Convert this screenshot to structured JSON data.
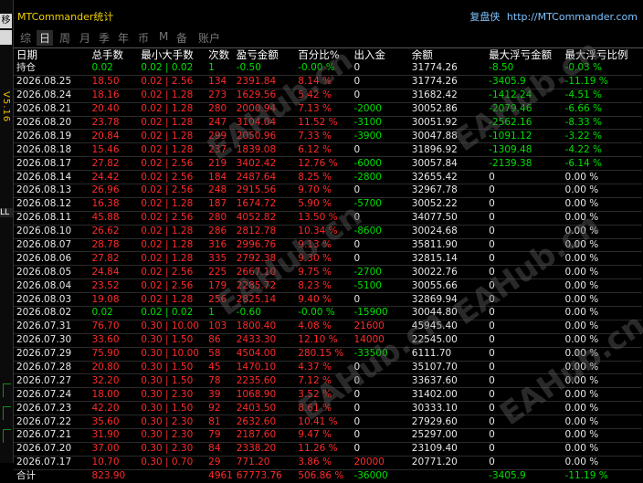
{
  "window": {
    "title": "MTCommander统计",
    "review_label": "复盘侠",
    "url": "http://MTCommander.com"
  },
  "sidebar": {
    "top_btn": "移",
    "version": "V5.16",
    "ll_label": "LL"
  },
  "tabs": [
    "综",
    "日",
    "周",
    "月",
    "季",
    "年",
    "币",
    "M",
    "备",
    "账户"
  ],
  "active_tab": "日",
  "columns": [
    "日期",
    "总手数",
    "最小大手数",
    "次数",
    "盈亏金额",
    "百分比%",
    "出入金",
    "余额",
    "最大浮亏金额",
    "最大浮亏比例"
  ],
  "rows": [
    {
      "date": "持仓",
      "lots": "0.02",
      "minmax": "0.02 | 0.02",
      "count": "1",
      "pnl": "-0.50",
      "pct": "-0.00 %",
      "io": "0",
      "bal": "31774.26",
      "dd": "-8.50",
      "ddp": "-0.03 %",
      "c": "green"
    },
    {
      "date": "2026.08.25",
      "lots": "18.50",
      "minmax": "0.02 | 2.56",
      "count": "134",
      "pnl": "2391.84",
      "pct": "8.14 %",
      "io": "0",
      "bal": "31774.26",
      "dd": "-3405.9",
      "ddp": "-11.19 %",
      "c": "red"
    },
    {
      "date": "2026.08.24",
      "lots": "18.16",
      "minmax": "0.02 | 1.28",
      "count": "273",
      "pnl": "1629.56",
      "pct": "5.42 %",
      "io": "0",
      "bal": "31682.42",
      "dd": "-1412.24",
      "ddp": "-4.51 %",
      "c": "red"
    },
    {
      "date": "2026.08.21",
      "lots": "20.40",
      "minmax": "0.02 | 1.28",
      "count": "280",
      "pnl": "2000.94",
      "pct": "7.13 %",
      "io": "-2000",
      "bal": "30052.86",
      "dd": "-2079.46",
      "ddp": "-6.66 %",
      "c": "red"
    },
    {
      "date": "2026.08.20",
      "lots": "23.78",
      "minmax": "0.02 | 1.28",
      "count": "247",
      "pnl": "3104.04",
      "pct": "11.52 %",
      "io": "-3100",
      "bal": "30051.92",
      "dd": "-2562.16",
      "ddp": "-8.33 %",
      "c": "red"
    },
    {
      "date": "2026.08.19",
      "lots": "20.84",
      "minmax": "0.02 | 1.28",
      "count": "299",
      "pnl": "2050.96",
      "pct": "7.33 %",
      "io": "-3900",
      "bal": "30047.88",
      "dd": "-1091.12",
      "ddp": "-3.22 %",
      "c": "red"
    },
    {
      "date": "2026.08.18",
      "lots": "15.46",
      "minmax": "0.02 | 1.28",
      "count": "237",
      "pnl": "1839.08",
      "pct": "6.12 %",
      "io": "0",
      "bal": "31896.92",
      "dd": "-1309.48",
      "ddp": "-4.22 %",
      "c": "red"
    },
    {
      "date": "2026.08.17",
      "lots": "27.82",
      "minmax": "0.02 | 2.56",
      "count": "219",
      "pnl": "3402.42",
      "pct": "12.76 %",
      "io": "-6000",
      "bal": "30057.84",
      "dd": "-2139.38",
      "ddp": "-6.14 %",
      "c": "red"
    },
    {
      "date": "2026.08.14",
      "lots": "24.42",
      "minmax": "0.02 | 2.56",
      "count": "184",
      "pnl": "2487.64",
      "pct": "8.25 %",
      "io": "-2800",
      "bal": "32655.42",
      "dd": "0",
      "ddp": "0.00 %",
      "c": "red"
    },
    {
      "date": "2026.08.13",
      "lots": "26.96",
      "minmax": "0.02 | 2.56",
      "count": "248",
      "pnl": "2915.56",
      "pct": "9.70 %",
      "io": "0",
      "bal": "32967.78",
      "dd": "0",
      "ddp": "0.00 %",
      "c": "red"
    },
    {
      "date": "2026.08.12",
      "lots": "16.38",
      "minmax": "0.02 | 1.28",
      "count": "187",
      "pnl": "1674.72",
      "pct": "5.90 %",
      "io": "-5700",
      "bal": "30052.22",
      "dd": "0",
      "ddp": "0.00 %",
      "c": "red"
    },
    {
      "date": "2026.08.11",
      "lots": "45.88",
      "minmax": "0.02 | 2.56",
      "count": "280",
      "pnl": "4052.82",
      "pct": "13.50 %",
      "io": "0",
      "bal": "34077.50",
      "dd": "0",
      "ddp": "0.00 %",
      "c": "red"
    },
    {
      "date": "2026.08.10",
      "lots": "26.62",
      "minmax": "0.02 | 1.28",
      "count": "286",
      "pnl": "2812.78",
      "pct": "10.34 %",
      "io": "-8600",
      "bal": "30024.68",
      "dd": "0",
      "ddp": "0.00 %",
      "c": "red"
    },
    {
      "date": "2026.08.07",
      "lots": "28.78",
      "minmax": "0.02 | 1.28",
      "count": "316",
      "pnl": "2996.76",
      "pct": "9.13 %",
      "io": "0",
      "bal": "35811.90",
      "dd": "0",
      "ddp": "0.00 %",
      "c": "red"
    },
    {
      "date": "2026.08.06",
      "lots": "27.82",
      "minmax": "0.02 | 1.28",
      "count": "335",
      "pnl": "2792.38",
      "pct": "9.30 %",
      "io": "0",
      "bal": "32815.14",
      "dd": "0",
      "ddp": "0.00 %",
      "c": "red"
    },
    {
      "date": "2026.08.05",
      "lots": "24.84",
      "minmax": "0.02 | 2.56",
      "count": "225",
      "pnl": "2667.10",
      "pct": "9.75 %",
      "io": "-2700",
      "bal": "30022.76",
      "dd": "0",
      "ddp": "0.00 %",
      "c": "red"
    },
    {
      "date": "2026.08.04",
      "lots": "23.52",
      "minmax": "0.02 | 2.56",
      "count": "179",
      "pnl": "2285.72",
      "pct": "8.23 %",
      "io": "-5100",
      "bal": "30055.66",
      "dd": "0",
      "ddp": "0.00 %",
      "c": "red"
    },
    {
      "date": "2026.08.03",
      "lots": "19.08",
      "minmax": "0.02 | 1.28",
      "count": "256",
      "pnl": "2825.14",
      "pct": "9.40 %",
      "io": "0",
      "bal": "32869.94",
      "dd": "0",
      "ddp": "0.00 %",
      "c": "red"
    },
    {
      "date": "2026.08.02",
      "lots": "0.02",
      "minmax": "0.02 | 0.02",
      "count": "1",
      "pnl": "-0.60",
      "pct": "-0.00 %",
      "io": "-15900",
      "bal": "30044.80",
      "dd": "0",
      "ddp": "0.00 %",
      "c": "green"
    },
    {
      "date": "2026.07.31",
      "lots": "76.70",
      "minmax": "0.30 | 10.00",
      "count": "103",
      "pnl": "1800.40",
      "pct": "4.08 %",
      "io": "21600",
      "bal": "45945.40",
      "dd": "0",
      "ddp": "0.00 %",
      "c": "red"
    },
    {
      "date": "2026.07.30",
      "lots": "33.60",
      "minmax": "0.30 | 1.50",
      "count": "86",
      "pnl": "2433.30",
      "pct": "12.10 %",
      "io": "14000",
      "bal": "22545.00",
      "dd": "0",
      "ddp": "0.00 %",
      "c": "red"
    },
    {
      "date": "2026.07.29",
      "lots": "75.90",
      "minmax": "0.30 | 10.00",
      "count": "58",
      "pnl": "4504.00",
      "pct": "280.15 %",
      "io": "-33500",
      "bal": "6111.70",
      "dd": "0",
      "ddp": "0.00 %",
      "c": "red"
    },
    {
      "date": "2026.07.28",
      "lots": "20.80",
      "minmax": "0.30 | 1.50",
      "count": "45",
      "pnl": "1470.10",
      "pct": "4.37 %",
      "io": "0",
      "bal": "35107.70",
      "dd": "0",
      "ddp": "0.00 %",
      "c": "red"
    },
    {
      "date": "2026.07.27",
      "lots": "32.20",
      "minmax": "0.30 | 1.50",
      "count": "78",
      "pnl": "2235.60",
      "pct": "7.12 %",
      "io": "0",
      "bal": "33637.60",
      "dd": "0",
      "ddp": "0.00 %",
      "c": "red"
    },
    {
      "date": "2026.07.24",
      "lots": "18.00",
      "minmax": "0.30 | 2.30",
      "count": "39",
      "pnl": "1068.90",
      "pct": "3.52 %",
      "io": "0",
      "bal": "31402.00",
      "dd": "0",
      "ddp": "0.00 %",
      "c": "red"
    },
    {
      "date": "2026.07.23",
      "lots": "42.20",
      "minmax": "0.30 | 1.50",
      "count": "92",
      "pnl": "2403.50",
      "pct": "8.61 %",
      "io": "0",
      "bal": "30333.10",
      "dd": "0",
      "ddp": "0.00 %",
      "c": "red"
    },
    {
      "date": "2026.07.22",
      "lots": "35.60",
      "minmax": "0.30 | 2.30",
      "count": "81",
      "pnl": "2632.60",
      "pct": "10.41 %",
      "io": "0",
      "bal": "27929.60",
      "dd": "0",
      "ddp": "0.00 %",
      "c": "red"
    },
    {
      "date": "2026.07.21",
      "lots": "31.90",
      "minmax": "0.30 | 2.30",
      "count": "79",
      "pnl": "2187.60",
      "pct": "9.47 %",
      "io": "0",
      "bal": "25297.00",
      "dd": "0",
      "ddp": "0.00 %",
      "c": "red"
    },
    {
      "date": "2026.07.20",
      "lots": "37.00",
      "minmax": "0.30 | 2.30",
      "count": "84",
      "pnl": "2338.20",
      "pct": "11.26 %",
      "io": "0",
      "bal": "23109.40",
      "dd": "0",
      "ddp": "0.00 %",
      "c": "red"
    },
    {
      "date": "2026.07.17",
      "lots": "10.70",
      "minmax": "0.30 | 0.70",
      "count": "29",
      "pnl": "771.20",
      "pct": "3.86 %",
      "io": "20000",
      "bal": "20771.20",
      "dd": "0",
      "ddp": "0.00 %",
      "c": "red"
    }
  ],
  "total": {
    "date": "合计",
    "lots": "823.90",
    "minmax": "",
    "count": "4961",
    "pnl": "67773.76",
    "pct": "506.86 %",
    "io": "-36000",
    "bal": "",
    "dd": "-3405.9",
    "ddp": "-11.19 %"
  },
  "watermark_text": "EAHub.cn",
  "colors": {
    "profit": "#ff2a2a",
    "loss": "#00e000",
    "title": "#f0d000",
    "link": "#7ec3ff"
  }
}
